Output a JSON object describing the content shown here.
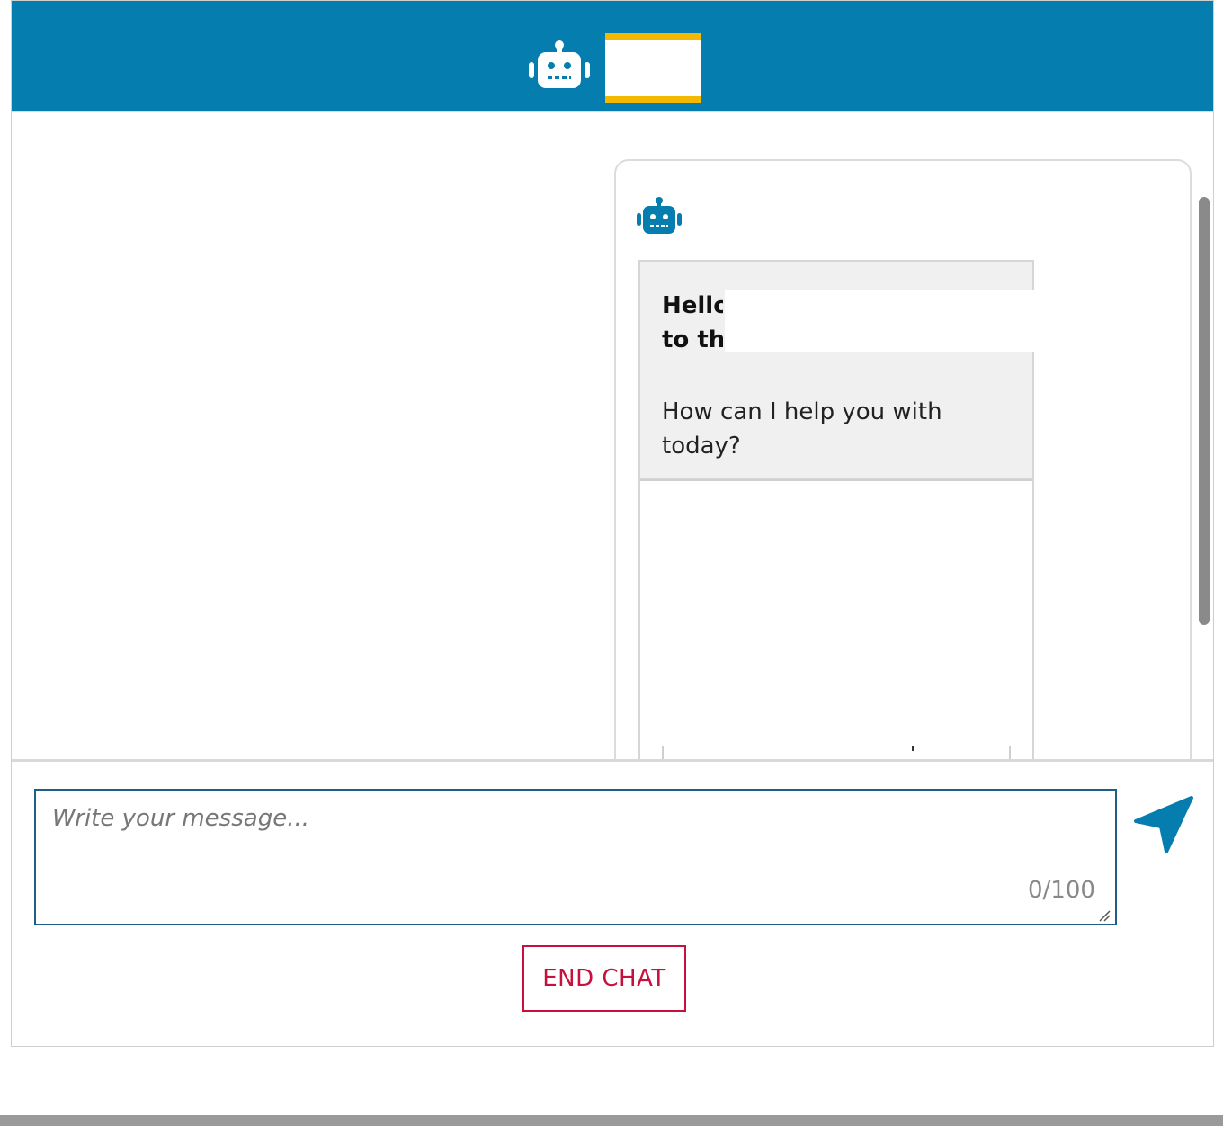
{
  "header": {
    "icon": "robot-icon",
    "title": "",
    "background_color": "#067daf",
    "title_border_color": "#f5b800"
  },
  "bot_message": {
    "avatar_icon": "robot-icon",
    "greeting_line1": "Hello",
    "greeting_line2": "to the",
    "question": "How can I help you with today?"
  },
  "composer": {
    "input_placeholder": "Write your message...",
    "input_value": "",
    "char_counter": "0/100",
    "send_icon": "send-arrow-icon",
    "end_chat_label": "END CHAT"
  },
  "colors": {
    "accent": "#067daf",
    "input_border": "#1f5f84",
    "end_chat": "#c8103e",
    "bubble_bg": "#f0f0f0"
  }
}
